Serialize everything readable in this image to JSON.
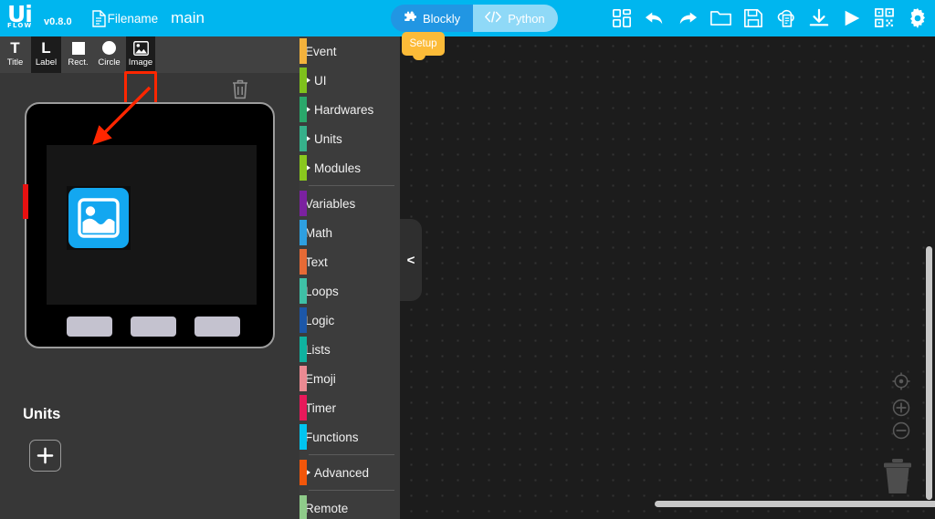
{
  "topbar": {
    "logo_main": "Ui",
    "logo_sub": "FLOW",
    "version": "v0.8.0",
    "file_icon": "document-icon",
    "file_label": "Filename",
    "file_name": "main",
    "tabs": [
      {
        "label": "Blockly",
        "icon": "puzzle-icon",
        "active": true
      },
      {
        "label": "Python",
        "icon": "code-icon",
        "active": false
      }
    ],
    "icons": [
      {
        "name": "blocks-icon"
      },
      {
        "name": "undo-icon"
      },
      {
        "name": "redo-icon"
      },
      {
        "name": "open-folder-icon"
      },
      {
        "name": "save-icon"
      },
      {
        "name": "cloud-upload-icon"
      },
      {
        "name": "download-icon"
      },
      {
        "name": "run-icon"
      },
      {
        "name": "qrcode-icon"
      },
      {
        "name": "settings-gear-icon"
      }
    ],
    "accent_color": "#00b6ef",
    "tab_active_color": "#2196e3",
    "tab_inactive_color": "#8fd9f7"
  },
  "left_panel": {
    "tools": [
      {
        "label": "Title",
        "glyph": "T",
        "icon": "title-tool-icon",
        "selected": false
      },
      {
        "label": "Label",
        "glyph": "L",
        "icon": "label-tool-icon",
        "selected": false
      },
      {
        "label": "Rect.",
        "glyph": "■",
        "icon": "rect-tool-icon",
        "selected": false
      },
      {
        "label": "Circle",
        "glyph": "●",
        "icon": "circle-tool-icon",
        "selected": false
      },
      {
        "label": "Image",
        "glyph": "🖼",
        "icon": "image-tool-icon",
        "selected": true
      }
    ],
    "highlight_color": "#ff2600",
    "trash_icon": "trash-icon",
    "device": {
      "placed_element": "image-widget",
      "buttons": [
        "button-a",
        "button-b",
        "button-c"
      ]
    },
    "units": {
      "title": "Units",
      "add_label": "+"
    }
  },
  "toolbox": {
    "categories": [
      {
        "label": "Event",
        "color": "#f3b23c",
        "expandable": false
      },
      {
        "label": "UI",
        "color": "#7fc11c",
        "expandable": true
      },
      {
        "label": "Hardwares",
        "color": "#2aa86b",
        "expandable": true
      },
      {
        "label": "Units",
        "color": "#36b08a",
        "expandable": true
      },
      {
        "label": "Modules",
        "color": "#8ac81e",
        "expandable": true
      },
      {
        "sep": true
      },
      {
        "label": "Variables",
        "color": "#7b21a0",
        "expandable": false
      },
      {
        "label": "Math",
        "color": "#2e9fe0",
        "expandable": false
      },
      {
        "label": "Text",
        "color": "#e66a35",
        "expandable": false
      },
      {
        "label": "Loops",
        "color": "#3fc0a6",
        "expandable": false
      },
      {
        "label": "Logic",
        "color": "#1c57a8",
        "expandable": false
      },
      {
        "label": "Lists",
        "color": "#0fb2a0",
        "expandable": false
      },
      {
        "label": "Emoji",
        "color": "#eb8a92",
        "expandable": false
      },
      {
        "label": "Timer",
        "color": "#e8195a",
        "expandable": false
      },
      {
        "label": "Functions",
        "color": "#00c4f0",
        "expandable": false
      },
      {
        "sep": true
      },
      {
        "label": "Advanced",
        "color": "#f2560a",
        "expandable": true
      },
      {
        "sep": true
      },
      {
        "label": "Remote",
        "color": "#8fcb8a",
        "expandable": false
      }
    ]
  },
  "workspace": {
    "setup_block_label": "Setup",
    "setup_block_color": "#fcbb38",
    "flyout_handle_glyph": "<",
    "controls": [
      {
        "name": "center-view-icon"
      },
      {
        "name": "zoom-in-icon"
      },
      {
        "name": "zoom-out-icon"
      },
      {
        "name": "workspace-trash-icon"
      }
    ]
  }
}
